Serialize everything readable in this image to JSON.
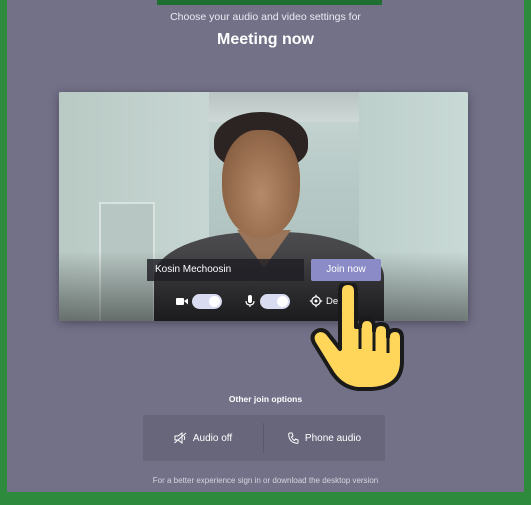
{
  "header": {
    "subtitle": "Choose your audio and video settings for",
    "title": "Meeting now"
  },
  "preview": {
    "name": "Kosin Mechoosin",
    "join_label": "Join now",
    "devices_label": "De",
    "camera_on": true,
    "mic_on": true,
    "camera_icon": "video-camera-icon",
    "mic_icon": "microphone-icon",
    "devices_icon": "gear-icon"
  },
  "other_options": {
    "heading": "Other join options",
    "audio_off_label": "Audio off",
    "audio_off_icon": "speaker-muted-icon",
    "phone_audio_label": "Phone audio",
    "phone_audio_icon": "phone-icon"
  },
  "footer": {
    "note": "For a better experience sign in or download the desktop version"
  },
  "colors": {
    "background": "#737188",
    "accent": "#6264a7",
    "join_button": "#8b8cc7",
    "frame_border": "#2e8b3e"
  }
}
